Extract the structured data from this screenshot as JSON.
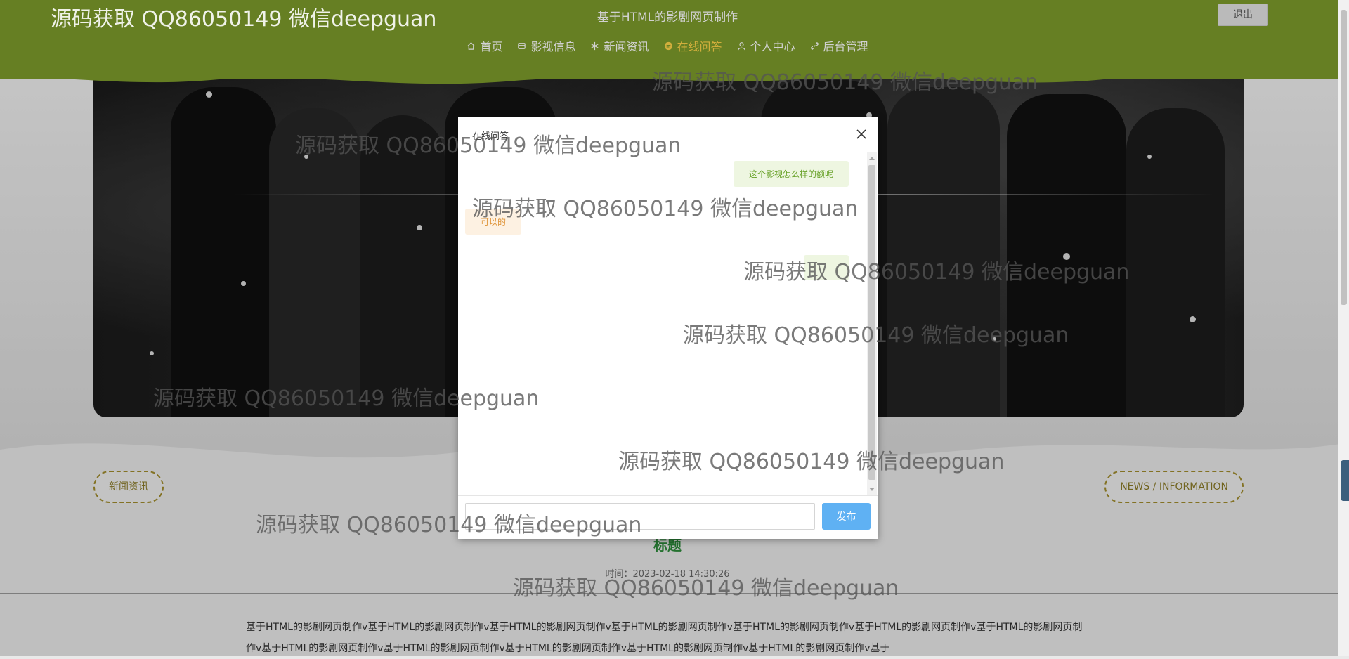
{
  "header": {
    "title": "基于HTML的影剧网页制作",
    "logout_label": "退出"
  },
  "nav": {
    "items": [
      {
        "label": "首页",
        "icon": "home-icon"
      },
      {
        "label": "影视信息",
        "icon": "film-icon"
      },
      {
        "label": "新闻资讯",
        "icon": "snowflake-icon"
      },
      {
        "label": "在线问答",
        "icon": "chat-bubble-icon",
        "active": true
      },
      {
        "label": "个人中心",
        "icon": "user-icon"
      },
      {
        "label": "后台管理",
        "icon": "link-icon"
      }
    ]
  },
  "section": {
    "left_pill": "新闻资讯",
    "right_pill": "NEWS / INFORMATION",
    "news_title": "标题",
    "news_time": "时间：2023-02-18 14:30:26",
    "news_body": "基于HTML的影剧网页制作v基于HTML的影剧网页制作v基于HTML的影剧网页制作v基于HTML的影剧网页制作v基于HTML的影剧网页制作v基于HTML的影剧网页制作v基于HTML的影剧网页制作v基于HTML的影剧网页制作v基于HTML的影剧网页制作v基于HTML的影剧网页制作v基于HTML的影剧网页制作v基于HTML的影剧网页制作v基于"
  },
  "dialog": {
    "title": "在线问答",
    "messages": [
      {
        "role": "question",
        "text": "这个影视怎么样的额呢"
      },
      {
        "role": "answer",
        "text": "可以的"
      },
      {
        "role": "question",
        "text": ""
      }
    ],
    "input_value": "",
    "publish_label": "发布"
  },
  "watermark": {
    "text": "源码获取 QQ86050149 微信deepguan"
  },
  "colors": {
    "header_green": "#7d9c2b",
    "active_nav": "#ffd54a",
    "publish_blue": "#5fb1f3",
    "title_green": "#2c8a3a"
  }
}
